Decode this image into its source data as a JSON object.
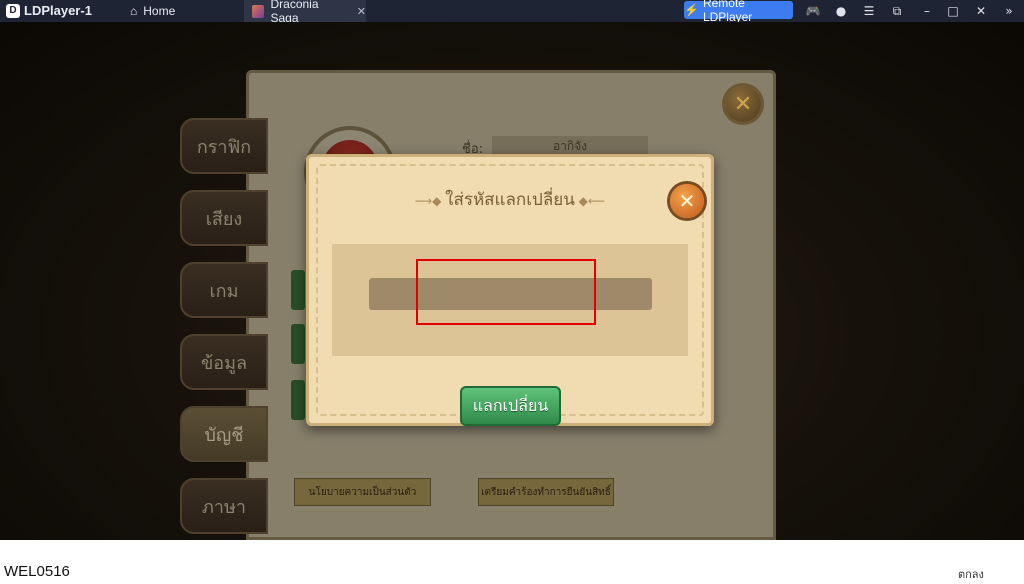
{
  "titlebar": {
    "app_name": "LDPlayer-1",
    "home_tab": "Home",
    "game_tab": "Draconia Saga",
    "remote_button": "Remote LDPlayer"
  },
  "game": {
    "side_tabs": [
      "กราฟิก",
      "เสียง",
      "เกม",
      "ข้อมูล",
      "บัญชี",
      "ภาษา"
    ],
    "active_tab_index": 4,
    "profile": {
      "name_label": "ชื่อ:",
      "name_value": "อากิจัง"
    },
    "bottom_buttons": [
      "นโยบายความเป็นส่วนตัว",
      "เตรียมคำร้องทำการยืนยันสิทธิ์"
    ]
  },
  "modal": {
    "title": "ใส่รหัสแลกเปลี่ยน",
    "input_value": "",
    "redeem_button": "แลกเปลี่ยน"
  },
  "footer": {
    "code": "WEL0516",
    "ok_label": "ตกลง"
  }
}
